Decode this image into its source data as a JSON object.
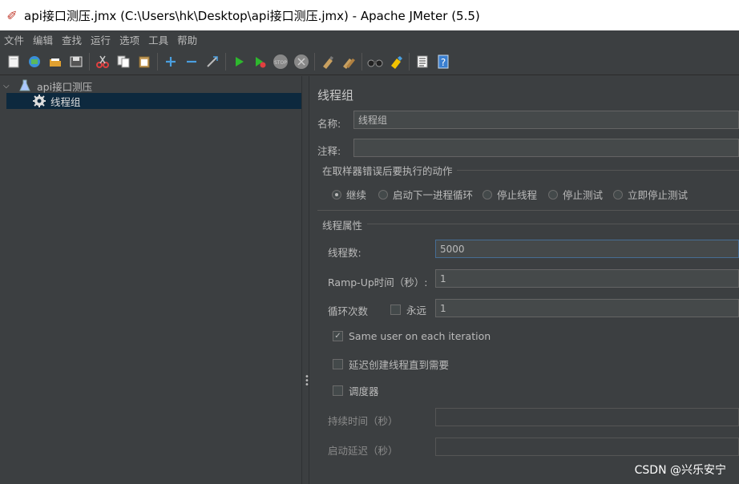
{
  "window": {
    "title": "api接口测压.jmx (C:\\Users\\hk\\Desktop\\api接口测压.jmx) - Apache JMeter (5.5)"
  },
  "menu": [
    "文件",
    "编辑",
    "查找",
    "运行",
    "选项",
    "工具",
    "帮助"
  ],
  "toolbar": {
    "icons": [
      "new-icon",
      "templates-icon",
      "open-icon",
      "save-icon",
      "cut-icon",
      "copy-icon",
      "paste-icon",
      "expand-icon",
      "collapse-icon",
      "toggle-icon",
      "start-icon",
      "start-no-pause-icon",
      "stop-icon",
      "shutdown-icon",
      "clear-icon",
      "clear-all-icon",
      "search-icon",
      "reset-search-icon",
      "function-helper-icon",
      "help-icon"
    ]
  },
  "tree": {
    "root_label": "api接口测压",
    "child_label": "线程组"
  },
  "thread_group": {
    "heading": "线程组",
    "name_label": "名称:",
    "name_value": "线程组",
    "comment_label": "注释:",
    "comment_value": "",
    "error_action_title": "在取样器错误后要执行的动作",
    "error_actions": [
      "继续",
      "启动下一进程循环",
      "停止线程",
      "停止测试",
      "立即停止测试"
    ],
    "error_action_selected": "继续",
    "props_title": "线程属性",
    "threads_label": "线程数:",
    "threads_value": "5000",
    "rampup_label": "Ramp-Up时间（秒）:",
    "rampup_value": "1",
    "loop_label": "循环次数",
    "forever_label": "永远",
    "forever_checked": false,
    "loop_value": "1",
    "same_user_label": "Same user on each iteration",
    "same_user_checked": true,
    "delay_label": "延迟创建线程直到需要",
    "delay_checked": false,
    "scheduler_label": "调度器",
    "scheduler_checked": false,
    "duration_label": "持续时间（秒）",
    "duration_value": "",
    "startup_delay_label": "启动延迟（秒）",
    "startup_delay_value": ""
  },
  "watermark": "CSDN @兴乐安宁",
  "colors": {
    "background": "#3c3f41",
    "selection": "#0d293e",
    "field": "#45494a",
    "focus_border": "#466d94"
  }
}
